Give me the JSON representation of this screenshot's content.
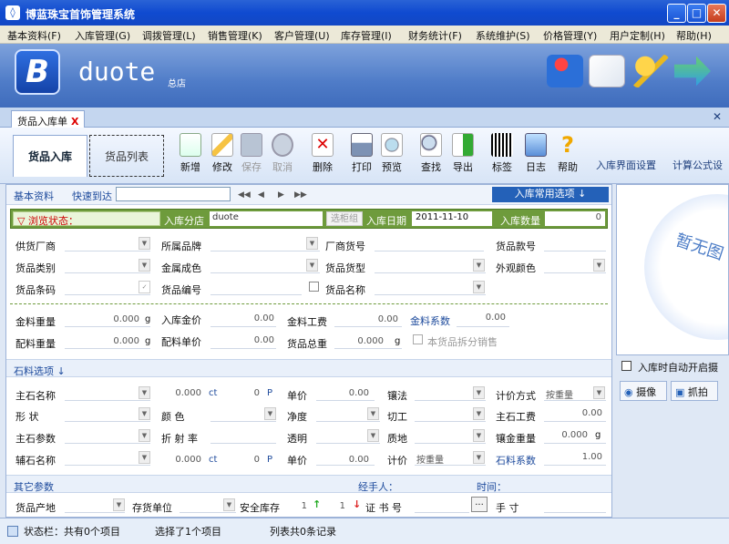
{
  "window": {
    "title": "博蓝珠宝首饰管理系统",
    "min": "_",
    "max": "□",
    "close": "✕"
  },
  "menu": [
    "基本资料(F)",
    "入库管理(G)",
    "调拨管理(L)",
    "销售管理(K)",
    "客户管理(U)",
    "库存管理(I)",
    "财务统计(F)",
    "系统维护(S)",
    "价格管理(Y)",
    "用户定制(H)",
    "帮助(H)"
  ],
  "banner": {
    "logo": "B",
    "brand": "duote",
    "sub": "总店"
  },
  "tab": {
    "label": "货品入库单",
    "close": "X",
    "closeall": "✕"
  },
  "toolbar": {
    "tab_in": "货品入库",
    "tab_list": "货品列表",
    "buttons": [
      "新增",
      "修改",
      "保存",
      "取消",
      "删除",
      "打印",
      "预览",
      "查找",
      "导出",
      "标签",
      "日志",
      "帮助"
    ],
    "link1": "入库界面设置",
    "link2": "计算公式设"
  },
  "nav": {
    "basic": "基本资料",
    "jump": "快速到达",
    "common": "入库常用选项 ↓"
  },
  "green": {
    "browse": "▽ 浏览状态：",
    "branch_label": "入库分店",
    "branch": "duote",
    "select": "选柜组",
    "date_label": "入库日期",
    "date": "2011-11-10",
    "qty_label": "入库数量",
    "qty": "0"
  },
  "f1": [
    "供货厂商",
    "所属品牌",
    "厂商货号",
    "货品款号"
  ],
  "f2": [
    "货品类别",
    "金属成色",
    "货品货型",
    "外观颜色"
  ],
  "f3": [
    "货品条码",
    "货品编号",
    "货品名称"
  ],
  "w1": {
    "gold_w": "金料重量",
    "gold_wv": "0.000",
    "g": "g",
    "in_price": "入库金价",
    "in_price_v": "0.00",
    "labor": "金料工费",
    "labor_v": "0.00",
    "coef": "金料系数",
    "coef_v": "0.00"
  },
  "w2": {
    "acc_w": "配料重量",
    "acc_wv": "0.000",
    "g": "g",
    "acc_price": "配料单价",
    "acc_price_v": "0.00",
    "total": "货品总重",
    "total_v": "0.000",
    "split": "本货品拆分销售"
  },
  "stone": {
    "title": "石料选项 ↓",
    "main_name": "主石名称",
    "qty": "0.000",
    "ct": "ct",
    "n": "0",
    "p": "P",
    "price": "单价",
    "price_v": "0.00",
    "set": "镶法",
    "calc": "计价方式",
    "calc_v": "按重量",
    "shape": "形 状",
    "color": "颜 色",
    "clarity": "净度",
    "cut": "切工",
    "main_labor": "主石工费",
    "main_labor_v": "0.00",
    "main_param": "主石参数",
    "refr": "折 射 率",
    "trans": "透明",
    "mat": "质地",
    "inlay": "镶金重量",
    "inlay_v": "0.000",
    "inlay_g": "g",
    "aux_name": "辅石名称",
    "aux_qty": "0.000",
    "aux_n": "0",
    "aux_price": "单价",
    "aux_price_v": "0.00",
    "aux_calc": "计价",
    "aux_calc_v": "按重量",
    "stone_coef": "石料系数",
    "stone_coef_v": "1.00"
  },
  "other": {
    "title": "其它参数",
    "handler": "经手人：",
    "time": "时间：",
    "origin": "货品产地",
    "unit": "存货单位",
    "safety": "安全库存",
    "s1": "1",
    "s2": "1",
    "cert": "证 书 号",
    "hand": "手 寸",
    "more": "..."
  },
  "right": {
    "noimg": "暂无图",
    "auto": "入库时自动开启摄",
    "cam": "摄像",
    "grab": "抓拍"
  },
  "status": {
    "label": "状态栏：",
    "total": "共有0个项目",
    "sel": "选择了1个项目",
    "list": "列表共0条记录"
  }
}
